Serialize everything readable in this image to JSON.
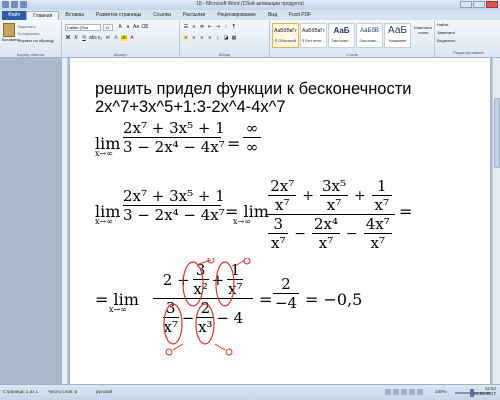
{
  "window": {
    "title": "18 - Microsoft Word (Сбой активации продукта)"
  },
  "tabs": [
    "Файл",
    "Главная",
    "Вставка",
    "Разметка страницы",
    "Ссылки",
    "Рассылки",
    "Рецензирование",
    "Вид",
    "Foxit PDF"
  ],
  "ribbon": {
    "clipboard": {
      "paste_label": "Вставить",
      "cut_label": "Вырезать",
      "copy_label": "Копировать",
      "format_label": "Формат по образцу",
      "group_label": "Буфер обмена"
    },
    "font": {
      "font_name": "Calibri (Осн",
      "font_size": "12",
      "group_label": "Шрифт"
    },
    "paragraph": {
      "group_label": "Абзац"
    },
    "styles": {
      "items": [
        {
          "preview": "АаБбВвГг",
          "name": "¶ Обычный"
        },
        {
          "preview": "АаБбВвГг",
          "name": "¶ Без инте..."
        },
        {
          "preview": "АаБ",
          "name": "Заголово..."
        },
        {
          "preview": "АаБбВ",
          "name": "Заголово..."
        },
        {
          "preview": "АаБ",
          "name": "Название"
        }
      ],
      "change_label": "Изменить стили",
      "group_label": "Стили"
    },
    "editing": {
      "find_label": "Найти",
      "replace_label": "Заменить",
      "select_label": "Выделить",
      "group_label": "Редактирование"
    }
  },
  "document": {
    "line1": "решить придел функции к бесконечности",
    "line2": "2x^7+3x^5+1:3-2x^4-4x^7",
    "eq1": {
      "lim": "lim",
      "sub": "x→∞",
      "num": "2x⁷ + 3x⁵ + 1",
      "den": "3 − 2x⁴ − 4x⁷",
      "eq": "=",
      "result_num": "∞",
      "result_den": "∞"
    },
    "eq2": {
      "lim": "lim",
      "sub": "x→∞",
      "num": "2x⁷ + 3x⁵ + 1",
      "den": "3 − 2x⁴ − 4x⁷",
      "eq": "= lim",
      "sub2": "x→∞",
      "n1": "2x⁷",
      "d1": "x⁷",
      "n2": "3x⁵",
      "d2": "x⁷",
      "n3": "1",
      "d3": "x⁷",
      "m1": "3",
      "e1": "x⁷",
      "m2": "2x⁴",
      "e2": "x⁷",
      "m3": "4x⁷",
      "e3": "x⁷",
      "tail": "="
    },
    "eq3": {
      "prefix": "= lim",
      "sub": "x→∞",
      "num_a": "2 +",
      "num_b_n": "3",
      "num_b_d": "x²",
      "num_plus": "+",
      "num_c_n": "1",
      "num_c_d": "x⁷",
      "den_a_n": "3",
      "den_a_d": "x⁷",
      "den_minus": "−",
      "den_b_n": "2",
      "den_b_d": "x³",
      "den_c": "− 4",
      "eq1": "=",
      "r_num": "2",
      "r_den": "−4",
      "eq2": "= −0,5"
    }
  },
  "status": {
    "page": "Страница: 1 из 1",
    "words": "Число слов: 6",
    "lang": "русский",
    "zoom": "100%",
    "time": "12:52",
    "date": "18.02.2017"
  }
}
